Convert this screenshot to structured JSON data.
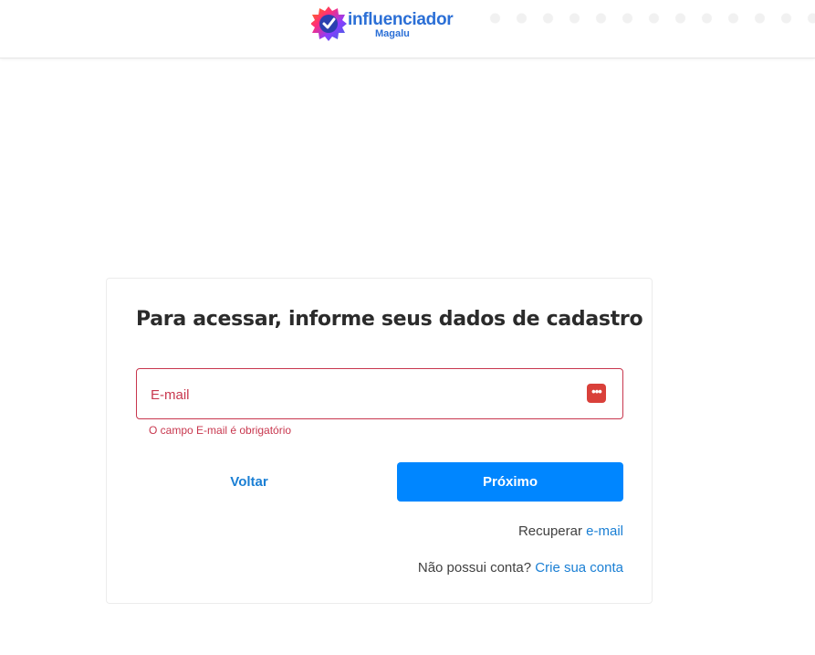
{
  "header": {
    "logo": {
      "name": "influenciador",
      "sub": "Magalu",
      "icon": "badge-check-icon"
    }
  },
  "form": {
    "title": "Para acessar, informe seus dados de cadastro",
    "email": {
      "placeholder": "E-mail",
      "value": "",
      "error": "O campo E-mail é obrigatório",
      "icon": "password-manager-icon",
      "border_color": "#c8374e"
    },
    "back_label": "Voltar",
    "next_label": "Próximo",
    "recover": {
      "text": "Recuperar",
      "link": "e-mail"
    },
    "signup": {
      "text": "Não possui conta?",
      "link": "Crie sua conta"
    }
  },
  "colors": {
    "primary": "#0086ff",
    "link": "#1a7fd4",
    "error": "#c8374e",
    "brand": "#2b6fd6"
  }
}
